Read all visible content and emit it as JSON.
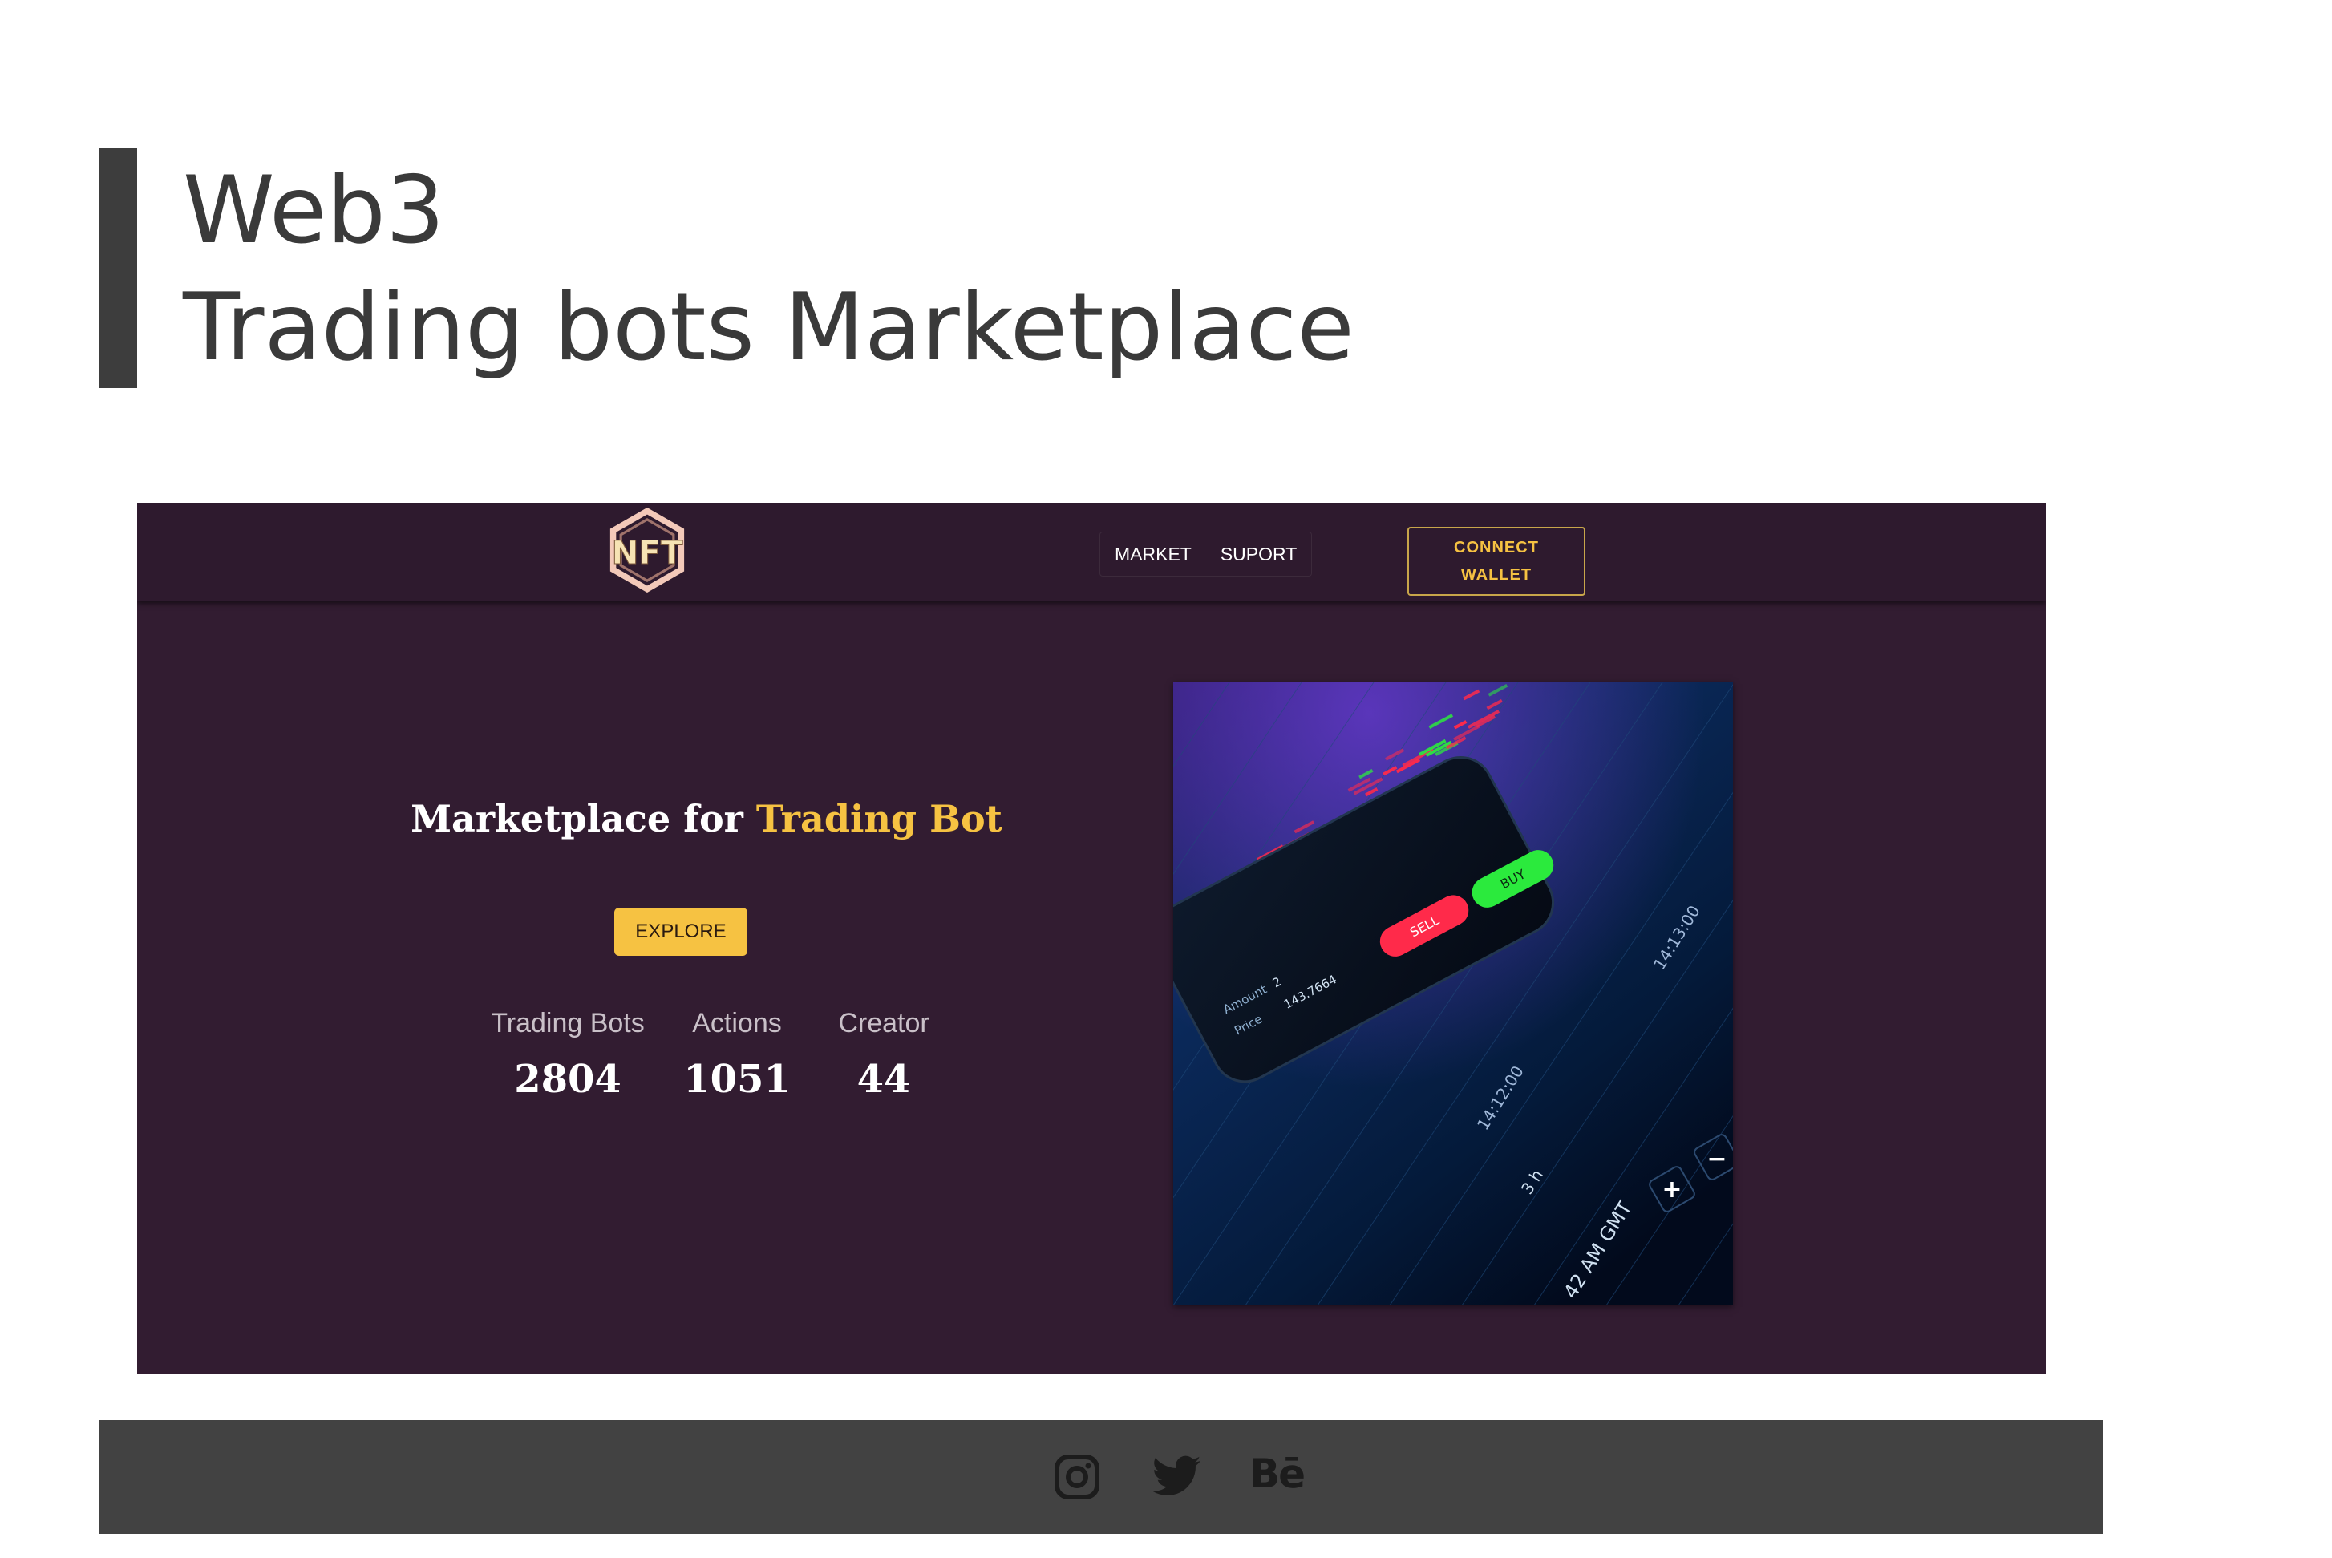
{
  "portfolio": {
    "title_line1": "Web3",
    "title_line2": "Trading bots Marketplace"
  },
  "nav": {
    "logo_text": "NFT",
    "links": [
      "MARKET",
      "SUPORT"
    ],
    "connect_line1": "CONNECT",
    "connect_line2": "WALLET"
  },
  "hero": {
    "title_prefix": "Marketplace for ",
    "title_highlight": "Trading Bot",
    "explore_label": "EXPLORE",
    "stats": [
      {
        "label": "Trading Bots",
        "value": "2804"
      },
      {
        "label": "Actions",
        "value": "1051"
      },
      {
        "label": "Creator",
        "value": "44"
      }
    ]
  },
  "hero_image": {
    "amount_label": "Amount",
    "amount_value": "2",
    "price_label": "Price",
    "price_value": "143.7664",
    "sell_label": "SELL",
    "buy_label": "BUY",
    "time_1": "14:13:00",
    "time_2": "14:12:00",
    "duration": "3 h",
    "bottom_time": "42 AM GMT"
  },
  "footer": {
    "icons": [
      "instagram-icon",
      "twitter-icon",
      "behance-icon"
    ],
    "behance_text": "Bē"
  },
  "colors": {
    "mockup_bg": "#321c31",
    "accent_yellow": "#f6c242",
    "footer_bg": "#424242",
    "sell_red": "#ff2a4a",
    "buy_green": "#2bea3d"
  }
}
